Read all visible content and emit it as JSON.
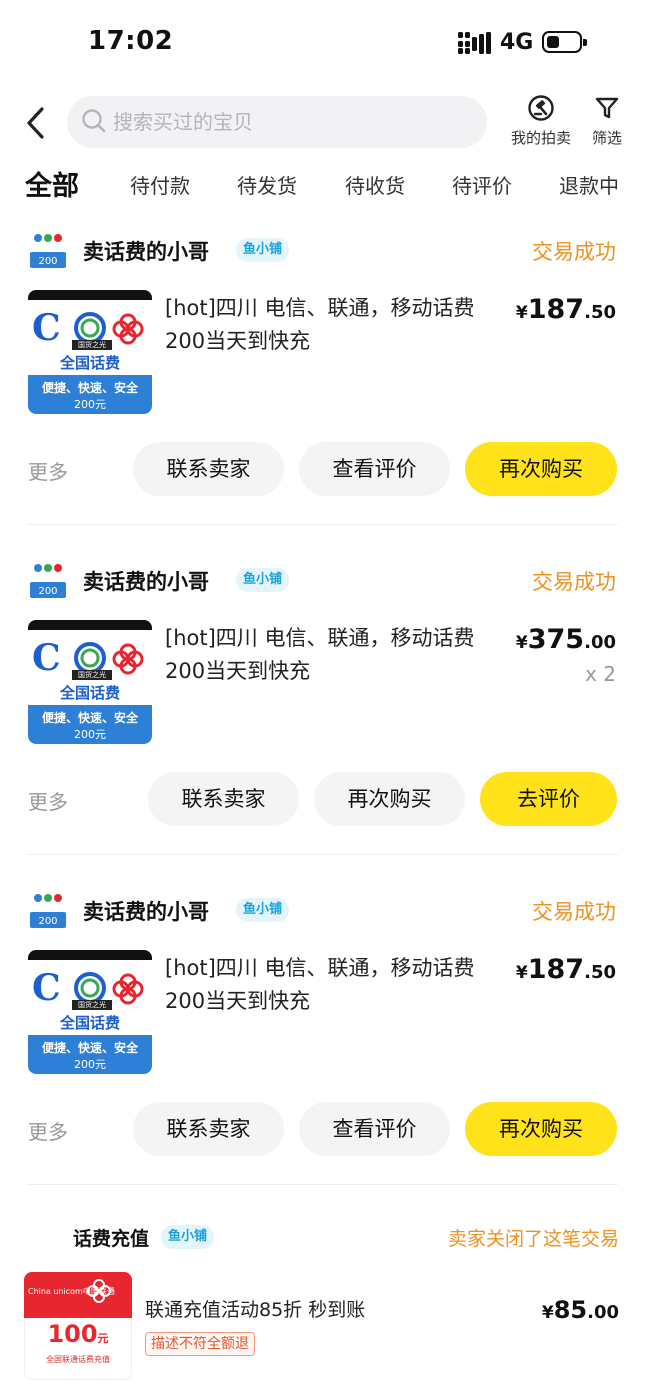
{
  "status_bar": {
    "time": "17:02",
    "network": "4G"
  },
  "header": {
    "search_placeholder": "搜索买过的宝贝",
    "auction_label": "我的拍卖",
    "filter_label": "筛选"
  },
  "tabs": [
    {
      "label": "全部",
      "active": true
    },
    {
      "label": "待付款"
    },
    {
      "label": "待发货"
    },
    {
      "label": "待收货"
    },
    {
      "label": "待评价"
    },
    {
      "label": "退款中"
    }
  ],
  "thumb_text": {
    "banner": "国货之光",
    "national": "全国话费",
    "features": "便捷、快速、安全",
    "amount": "200元"
  },
  "orders": [
    {
      "shop": "卖话费的小哥",
      "badge": "鱼小铺",
      "status": "交易成功",
      "title": "[hot]四川 电信、联通，移动话费200当天到快充",
      "price": {
        "currency": "¥",
        "int": "187",
        "dec": ".50"
      },
      "qty": "",
      "more": "更多",
      "buttons": [
        "联系卖家",
        "查看评价",
        "再次购买"
      ]
    },
    {
      "shop": "卖话费的小哥",
      "badge": "鱼小铺",
      "status": "交易成功",
      "title": "[hot]四川 电信、联通，移动话费200当天到快充",
      "price": {
        "currency": "¥",
        "int": "375",
        "dec": ".00"
      },
      "qty": "x 2",
      "more": "更多",
      "buttons": [
        "联系卖家",
        "再次购买",
        "去评价"
      ]
    },
    {
      "shop": "卖话费的小哥",
      "badge": "鱼小铺",
      "status": "交易成功",
      "title": "[hot]四川 电信、联通，移动话费200当天到快充",
      "price": {
        "currency": "¥",
        "int": "187",
        "dec": ".50"
      },
      "qty": "",
      "more": "更多",
      "buttons": [
        "联系卖家",
        "查看评价",
        "再次购买"
      ]
    },
    {
      "shop": "话费充值",
      "badge": "鱼小铺",
      "status": "卖家关闭了这笔交易",
      "title": "联通充值活动85折 秒到账",
      "tag": "描述不符全额退",
      "price": {
        "currency": "¥",
        "int": "85",
        "dec": ".00"
      },
      "thumb": {
        "brand": "China unicom中国联通",
        "amount": "100",
        "unit": "元",
        "sub": "全国联通话费充值"
      }
    }
  ],
  "colors": {
    "accent_yellow": "#ffe21a",
    "status_orange": "#f0901e",
    "badge_blue": "#1aa3d8"
  }
}
